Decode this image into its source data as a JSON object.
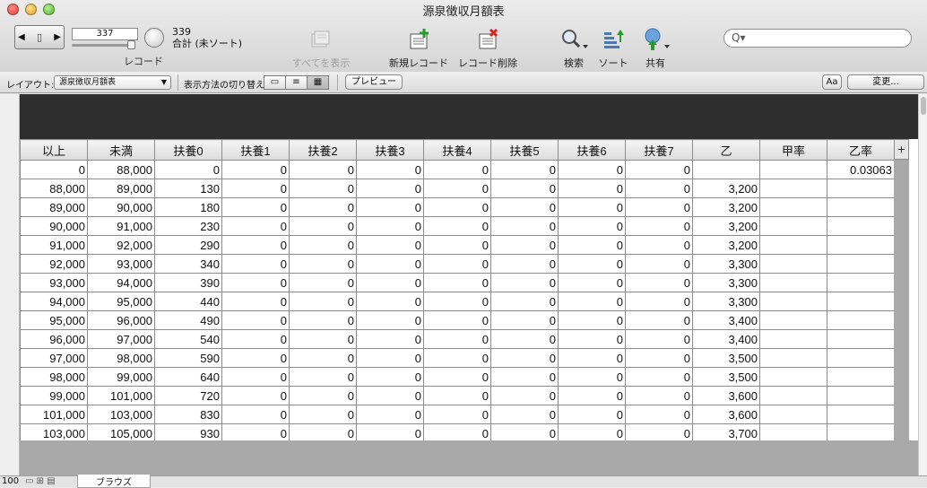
{
  "window": {
    "title": "源泉徴収月額表"
  },
  "toolbar": {
    "record_current": "337",
    "record_label": "レコード",
    "found_count": "339",
    "found_status": "合計 (未ソート)",
    "show_all": "すべてを表示",
    "new_record": "新規レコード",
    "delete_record": "レコード削除",
    "find": "検索",
    "sort": "ソート",
    "share": "共有",
    "search_placeholder": "Q▾"
  },
  "layoutbar": {
    "layout_label": "レイアウト:",
    "layout_value": "源泉徴収月額表",
    "view_label": "表示方法の切り替え:",
    "preview": "プレビュー",
    "aa": "Aa",
    "change": "変更..."
  },
  "table": {
    "columns": [
      "以上",
      "未満",
      "扶養0",
      "扶養1",
      "扶養2",
      "扶養3",
      "扶養4",
      "扶養5",
      "扶養6",
      "扶養7",
      "乙",
      "甲率",
      "乙率"
    ],
    "rows": [
      [
        "0",
        "88,000",
        "0",
        "0",
        "0",
        "0",
        "0",
        "0",
        "0",
        "0",
        "",
        "",
        "0.03063"
      ],
      [
        "88,000",
        "89,000",
        "130",
        "0",
        "0",
        "0",
        "0",
        "0",
        "0",
        "0",
        "3,200",
        "",
        ""
      ],
      [
        "89,000",
        "90,000",
        "180",
        "0",
        "0",
        "0",
        "0",
        "0",
        "0",
        "0",
        "3,200",
        "",
        ""
      ],
      [
        "90,000",
        "91,000",
        "230",
        "0",
        "0",
        "0",
        "0",
        "0",
        "0",
        "0",
        "3,200",
        "",
        ""
      ],
      [
        "91,000",
        "92,000",
        "290",
        "0",
        "0",
        "0",
        "0",
        "0",
        "0",
        "0",
        "3,200",
        "",
        ""
      ],
      [
        "92,000",
        "93,000",
        "340",
        "0",
        "0",
        "0",
        "0",
        "0",
        "0",
        "0",
        "3,300",
        "",
        ""
      ],
      [
        "93,000",
        "94,000",
        "390",
        "0",
        "0",
        "0",
        "0",
        "0",
        "0",
        "0",
        "3,300",
        "",
        ""
      ],
      [
        "94,000",
        "95,000",
        "440",
        "0",
        "0",
        "0",
        "0",
        "0",
        "0",
        "0",
        "3,300",
        "",
        ""
      ],
      [
        "95,000",
        "96,000",
        "490",
        "0",
        "0",
        "0",
        "0",
        "0",
        "0",
        "0",
        "3,400",
        "",
        ""
      ],
      [
        "96,000",
        "97,000",
        "540",
        "0",
        "0",
        "0",
        "0",
        "0",
        "0",
        "0",
        "3,400",
        "",
        ""
      ],
      [
        "97,000",
        "98,000",
        "590",
        "0",
        "0",
        "0",
        "0",
        "0",
        "0",
        "0",
        "3,500",
        "",
        ""
      ],
      [
        "98,000",
        "99,000",
        "640",
        "0",
        "0",
        "0",
        "0",
        "0",
        "0",
        "0",
        "3,500",
        "",
        ""
      ],
      [
        "99,000",
        "101,000",
        "720",
        "0",
        "0",
        "0",
        "0",
        "0",
        "0",
        "0",
        "3,600",
        "",
        ""
      ],
      [
        "101,000",
        "103,000",
        "830",
        "0",
        "0",
        "0",
        "0",
        "0",
        "0",
        "0",
        "3,600",
        "",
        ""
      ],
      [
        "103,000",
        "105,000",
        "930",
        "0",
        "0",
        "0",
        "0",
        "0",
        "0",
        "0",
        "3,700",
        "",
        ""
      ]
    ]
  },
  "statusbar": {
    "zoom": "100",
    "mode": "ブラウズ"
  }
}
